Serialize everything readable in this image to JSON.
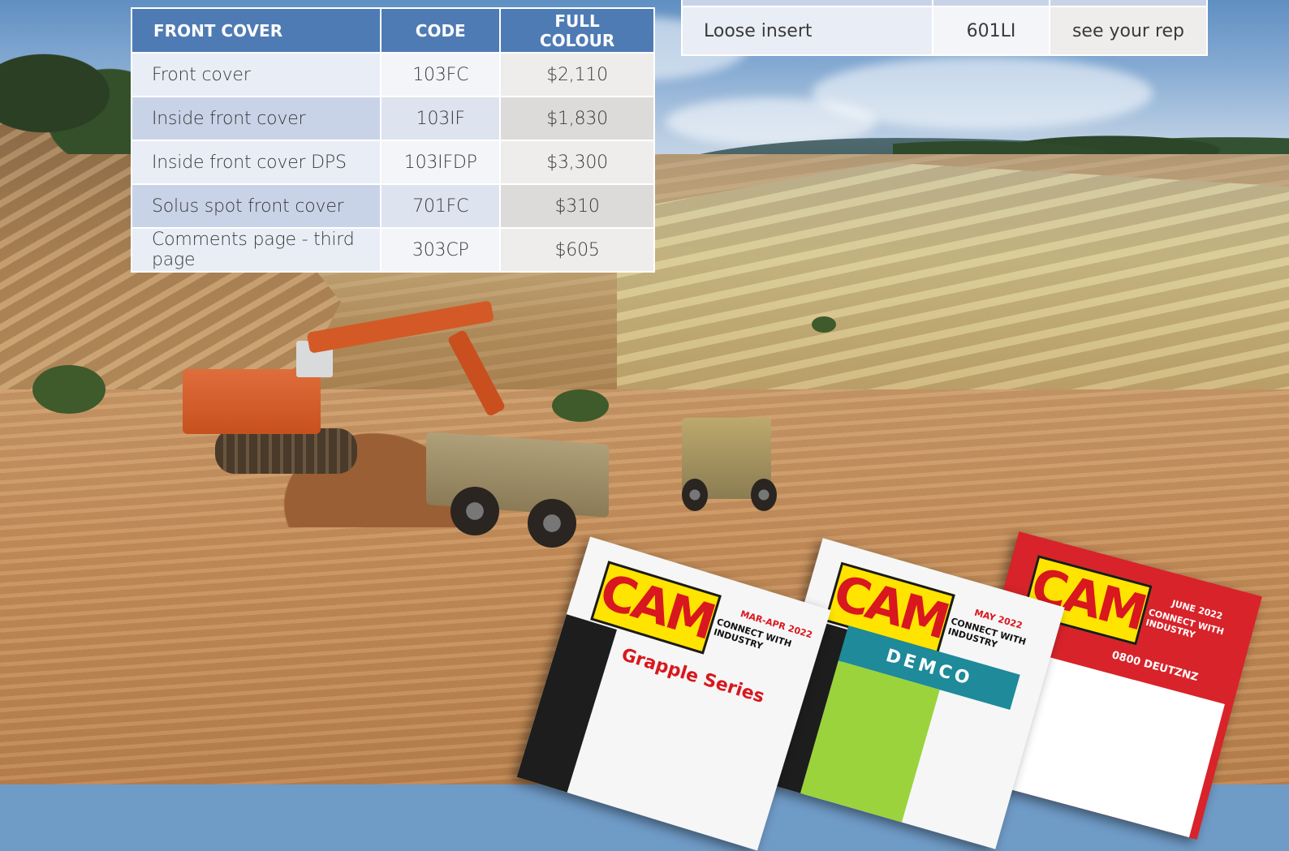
{
  "front_cover_table": {
    "headers": [
      "FRONT COVER",
      "CODE",
      "FULL COLOUR"
    ],
    "rows": [
      {
        "item": "Front cover",
        "code": "103FC",
        "price": "$2,110"
      },
      {
        "item": "Inside front cover",
        "code": "103IF",
        "price": "$1,830"
      },
      {
        "item": "Inside front cover DPS",
        "code": "103IFDP",
        "price": "$3,300"
      },
      {
        "item": "Solus spot front cover",
        "code": "701FC",
        "price": "$310"
      },
      {
        "item": "Comments page - third page",
        "code": "303CP",
        "price": "$605"
      }
    ]
  },
  "insert_table": {
    "rows": [
      {
        "item": "Loose insert",
        "code": "601LI",
        "price": "see your rep"
      }
    ]
  },
  "colors": {
    "header_blue": "#4f7bb4",
    "row_light": "#e9edf6",
    "row_dark": "#c9d3e8"
  },
  "magazines": [
    {
      "logo": "CAM",
      "date": "MAR-APR 2022",
      "tagline": "CONNECT WITH INDUSTRY",
      "headline": "Grapple Series"
    },
    {
      "logo": "CAM",
      "date": "MAY 2022",
      "tagline": "CONNECT WITH INDUSTRY",
      "headline": "DEMCO"
    },
    {
      "logo": "CAM",
      "date": "JUNE 2022",
      "tagline": "CONNECT WITH INDUSTRY",
      "headline": "0800 DEUTZNZ"
    }
  ]
}
